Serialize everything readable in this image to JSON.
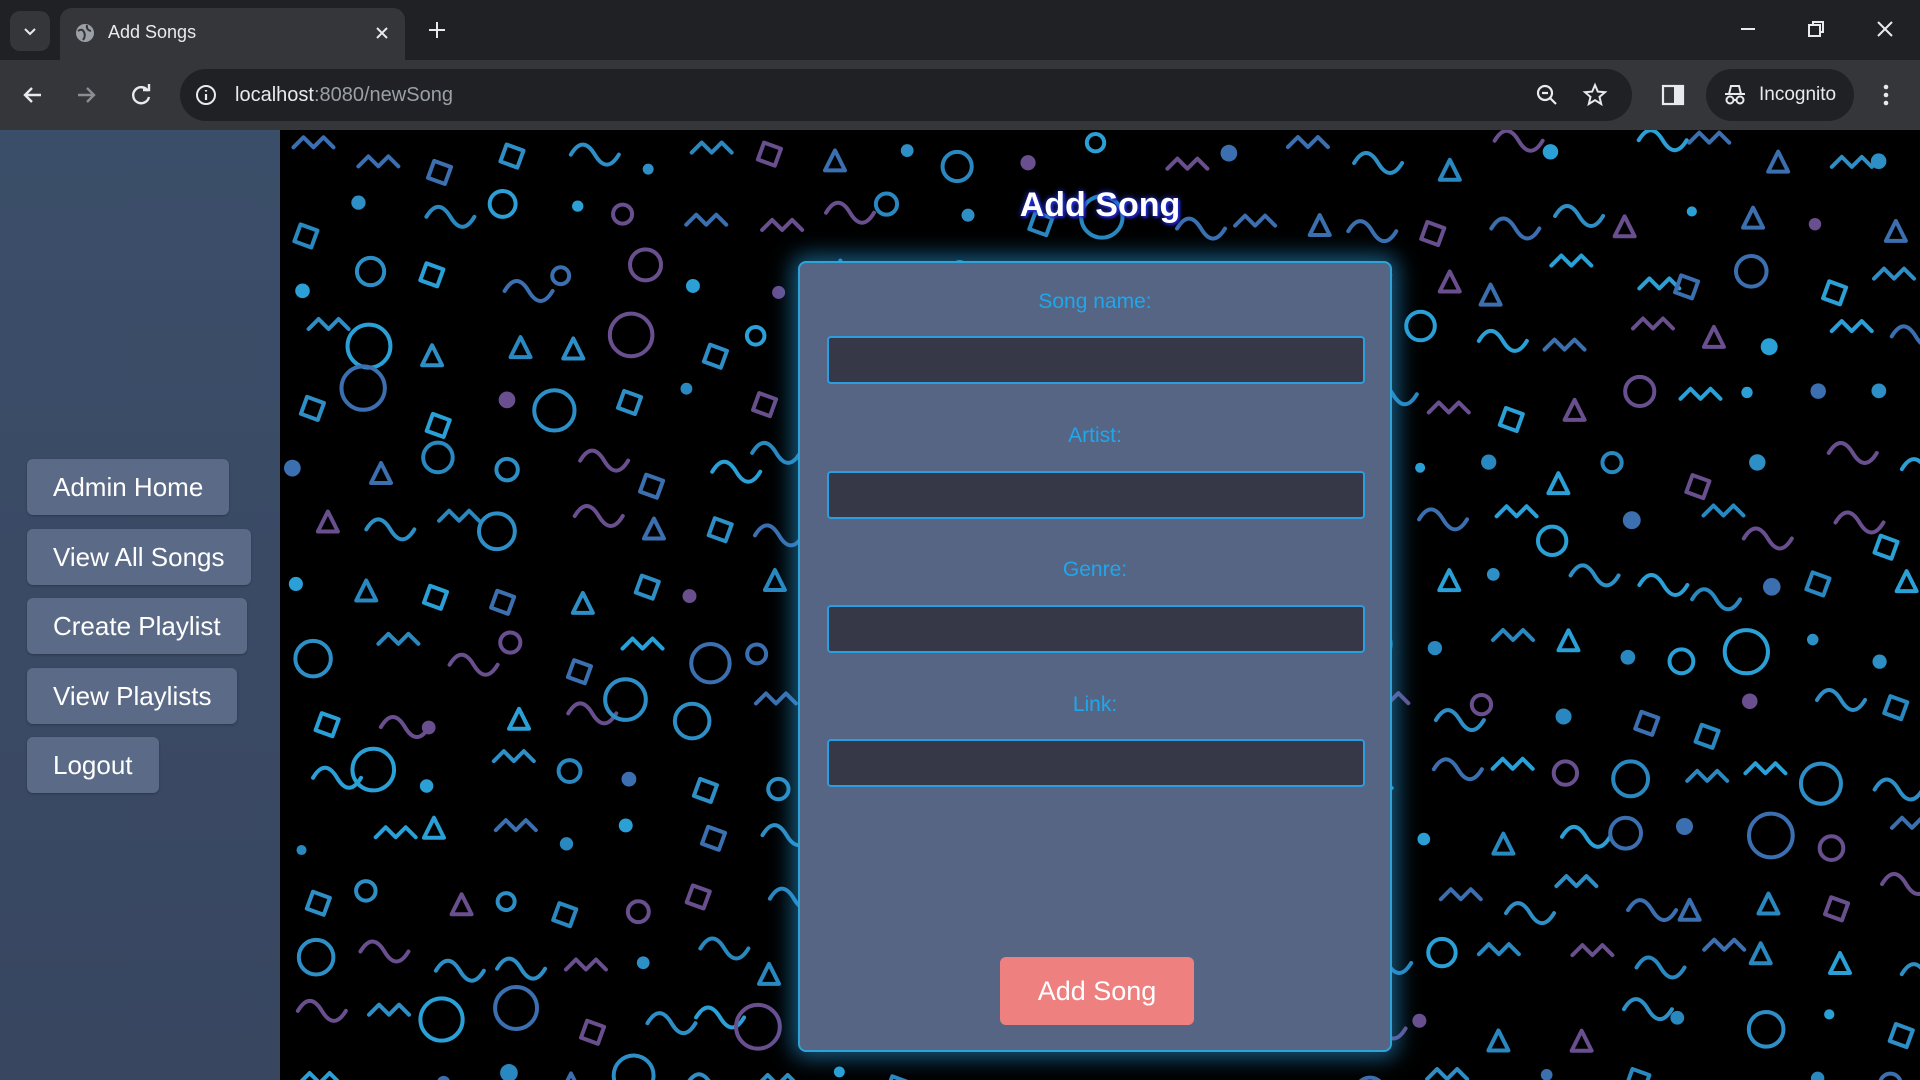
{
  "browser": {
    "tab_title": "Add Songs",
    "url_host": "localhost",
    "url_rest": ":8080/newSong",
    "incognito_label": "Incognito"
  },
  "sidebar": {
    "items": [
      {
        "label": "Admin Home"
      },
      {
        "label": "View All Songs"
      },
      {
        "label": "Create Playlist"
      },
      {
        "label": "View Playlists"
      },
      {
        "label": "Logout"
      }
    ]
  },
  "main": {
    "title": "Add Song",
    "form": {
      "fields": [
        {
          "label": "Song name:",
          "value": ""
        },
        {
          "label": "Artist:",
          "value": ""
        },
        {
          "label": "Genre:",
          "value": ""
        },
        {
          "label": "Link:",
          "value": ""
        }
      ],
      "submit_label": "Add Song"
    }
  },
  "colors": {
    "sidebar_bg": "#3b4e69",
    "sidebar_button": "#5b6a86",
    "card_bg": "#556583",
    "accent_blue": "#1fa7ee",
    "submit_button": "#ef8080"
  }
}
